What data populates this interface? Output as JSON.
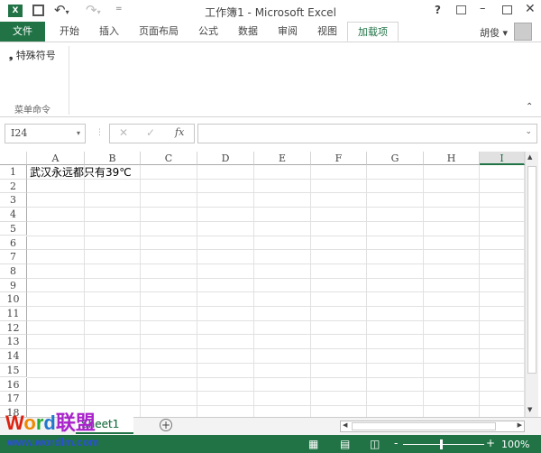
{
  "app": {
    "title": "工作簿1 - Microsoft Excel",
    "accent": "#217346"
  },
  "quick_access": {
    "icons": [
      "excel-logo-icon",
      "save-icon",
      "undo-icon",
      "redo-icon",
      "customize-icon"
    ]
  },
  "window_controls": {
    "help": "?"
  },
  "tabs": [
    {
      "label": "文件"
    },
    {
      "label": "开始"
    },
    {
      "label": "插入"
    },
    {
      "label": "页面布局"
    },
    {
      "label": "公式"
    },
    {
      "label": "数据"
    },
    {
      "label": "审阅"
    },
    {
      "label": "视图"
    },
    {
      "label": "加载项",
      "active": true
    }
  ],
  "user": {
    "name": "胡俊"
  },
  "ribbon": {
    "command": "特殊符号",
    "group_label": "菜单命令"
  },
  "formula_bar": {
    "name_box": "I24",
    "fx": "fx",
    "value": ""
  },
  "columns": [
    "A",
    "B",
    "C",
    "D",
    "E",
    "F",
    "G",
    "H",
    "I"
  ],
  "rows": [
    "1",
    "2",
    "3",
    "4",
    "5",
    "6",
    "7",
    "8",
    "9",
    "10",
    "11",
    "12",
    "13",
    "14",
    "15",
    "16",
    "17",
    "18"
  ],
  "cells": {
    "A1": "武汉永远都只有39℃"
  },
  "selected_cell": "I24",
  "sheets": [
    {
      "label": "Sheet1",
      "visible_text": "heet1"
    }
  ],
  "watermark": {
    "logo": "Word联盟",
    "url": "www.wordlm.com"
  },
  "status_bar": {
    "zoom": "100%"
  }
}
